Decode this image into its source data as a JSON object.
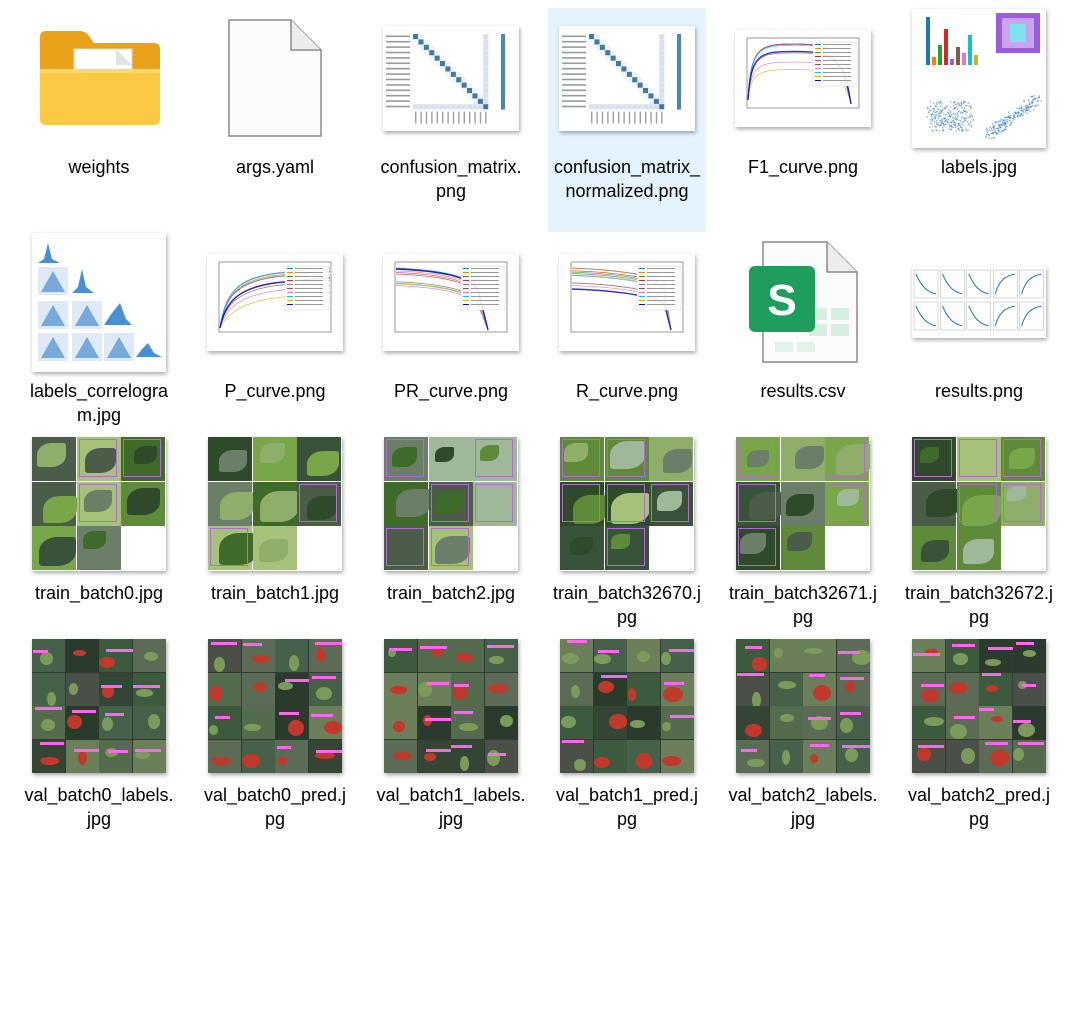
{
  "files": [
    {
      "name": "weights",
      "type": "folder",
      "selected": false
    },
    {
      "name": "args.yaml",
      "type": "blank",
      "selected": false
    },
    {
      "name": "confusion_matrix.png",
      "type": "matrix",
      "selected": false
    },
    {
      "name": "confusion_matrix_normalized.png",
      "type": "matrix",
      "selected": true
    },
    {
      "name": "F1_curve.png",
      "type": "curve",
      "selected": false
    },
    {
      "name": "labels.jpg",
      "type": "labels",
      "selected": false
    },
    {
      "name": "labels_correlogram.jpg",
      "type": "correlogram",
      "selected": false
    },
    {
      "name": "P_curve.png",
      "type": "curve",
      "selected": false
    },
    {
      "name": "PR_curve.png",
      "type": "curve",
      "selected": false
    },
    {
      "name": "R_curve.png",
      "type": "curve",
      "selected": false
    },
    {
      "name": "results.csv",
      "type": "csv",
      "selected": false
    },
    {
      "name": "results.png",
      "type": "results",
      "selected": false
    },
    {
      "name": "train_batch0.jpg",
      "type": "photos",
      "selected": false
    },
    {
      "name": "train_batch1.jpg",
      "type": "photos",
      "selected": false
    },
    {
      "name": "train_batch2.jpg",
      "type": "photos",
      "selected": false
    },
    {
      "name": "train_batch32670.jpg",
      "type": "photos",
      "selected": false
    },
    {
      "name": "train_batch32671.jpg",
      "type": "photos",
      "selected": false
    },
    {
      "name": "train_batch32672.jpg",
      "type": "photos",
      "selected": false
    },
    {
      "name": "val_batch0_labels.jpg",
      "type": "val",
      "selected": false
    },
    {
      "name": "val_batch0_pred.jpg",
      "type": "val",
      "selected": false
    },
    {
      "name": "val_batch1_labels.jpg",
      "type": "val",
      "selected": false
    },
    {
      "name": "val_batch1_pred.jpg",
      "type": "val",
      "selected": false
    },
    {
      "name": "val_batch2_labels.jpg",
      "type": "val",
      "selected": false
    },
    {
      "name": "val_batch2_pred.jpg",
      "type": "val",
      "selected": false
    }
  ],
  "icons": {
    "folder": "folder-icon",
    "blank": "yaml-file-icon",
    "csv": "spreadsheet-icon"
  },
  "csv_badge": "S",
  "colors": {
    "selection": "#e5f3ff",
    "folder_back": "#e9a21a",
    "folder_front": "#fcc945",
    "csv_green": "#1e9e5c",
    "matrix_blue": "#1f5f9f",
    "val_box": "#ff66ee"
  }
}
